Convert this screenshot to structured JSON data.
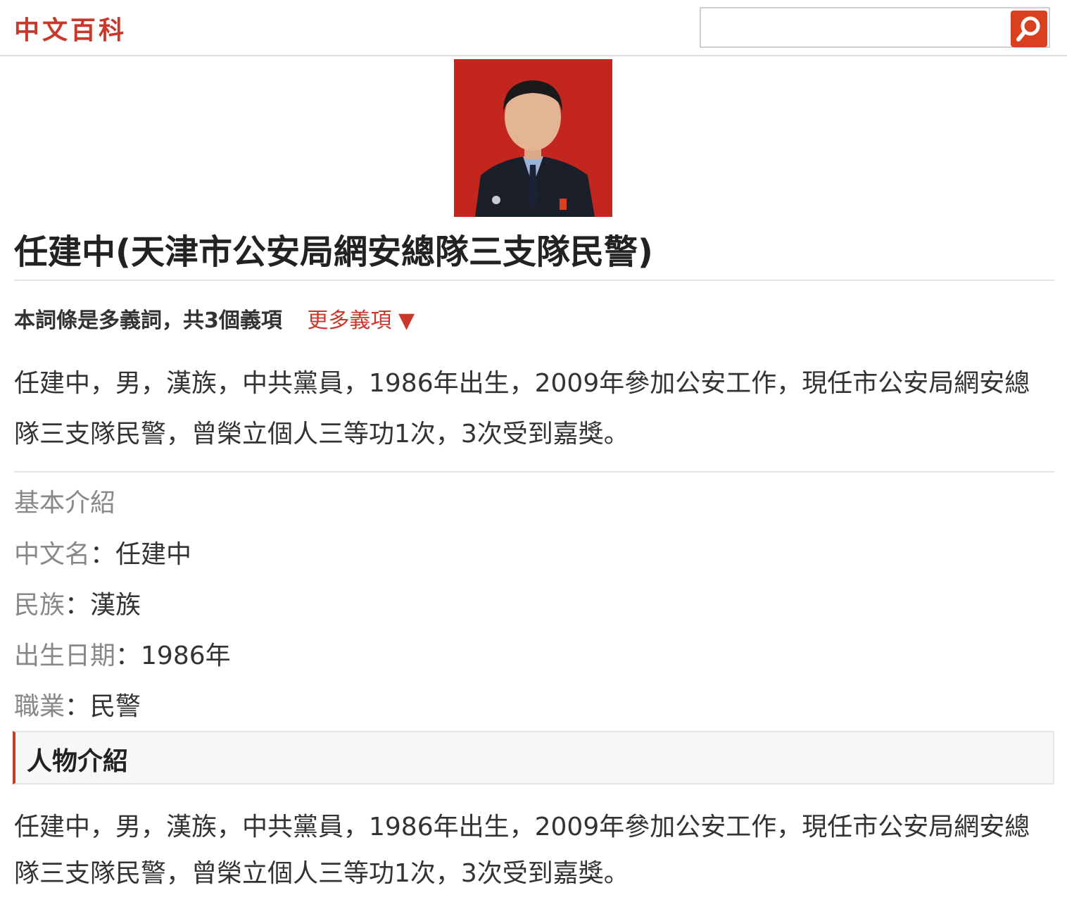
{
  "header": {
    "logo": "中文百科",
    "search": {
      "value": "",
      "placeholder": ""
    },
    "search_icon": "magnifier-icon",
    "accent_color": "#d9411e"
  },
  "article": {
    "title": "任建中(天津市公安局網安總隊三支隊民警)",
    "polysemy_note": "本詞條是多義詞，共3個義項",
    "more_senses": "更多義項 ▼",
    "summary": "任建中，男，漢族，中共黨員，1986年出生，2009年參加公安工作，現任市公安局網安總隊三支隊民警，曾榮立個人三等功1次，3次受到嘉獎。"
  },
  "basic_info": {
    "heading": "基本介紹",
    "fields": [
      {
        "label": "中文名",
        "sep": "：",
        "value": "任建中"
      },
      {
        "label": "民族",
        "sep": "：",
        "value": "漢族"
      },
      {
        "label": "出生日期",
        "sep": "：",
        "value": "1986年"
      },
      {
        "label": "職業",
        "sep": "：",
        "value": "民警"
      }
    ]
  },
  "section": {
    "title": "人物介紹",
    "body": "任建中，男，漢族，中共黨員，1986年出生，2009年參加公安工作，現任市公安局網安總隊三支隊民警，曾榮立個人三等功1次，3次受到嘉獎。"
  }
}
